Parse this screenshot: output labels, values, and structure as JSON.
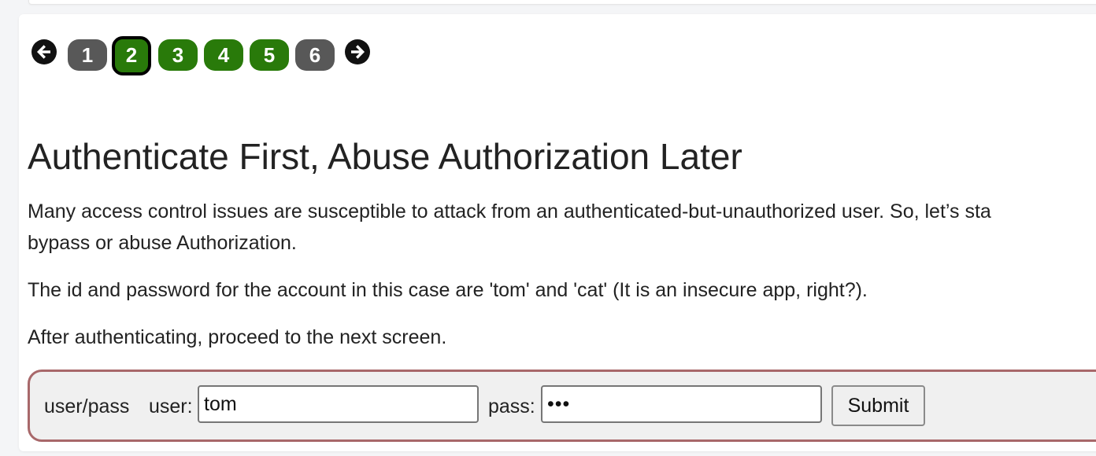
{
  "pagination": {
    "prev_icon": "arrow-left-circle-icon",
    "next_icon": "arrow-right-circle-icon",
    "pages": [
      {
        "label": "1",
        "state": "visited",
        "color": "#585858"
      },
      {
        "label": "2",
        "state": "current",
        "color": "#297a0a"
      },
      {
        "label": "3",
        "state": "available",
        "color": "#297a0a"
      },
      {
        "label": "4",
        "state": "available",
        "color": "#297a0a"
      },
      {
        "label": "5",
        "state": "available",
        "color": "#297a0a"
      },
      {
        "label": "6",
        "state": "visited",
        "color": "#585858"
      }
    ]
  },
  "lesson": {
    "title": "Authenticate First, Abuse Authorization Later",
    "paragraph1_line1": "Many access control issues are susceptible to attack from an authenticated-but-unauthorized user. So, let’s sta",
    "paragraph1_line2": "bypass or abuse Authorization.",
    "paragraph2": "The id and password for the account in this case are 'tom' and 'cat' (It is an insecure app, right?).",
    "paragraph3": "After authenticating, proceed to the next screen."
  },
  "form": {
    "legend": "user/pass",
    "user_label": "user:",
    "user_value": "tom",
    "pass_label": "pass:",
    "pass_value": "cat",
    "submit_label": "Submit",
    "border_color": "#a8686a"
  }
}
